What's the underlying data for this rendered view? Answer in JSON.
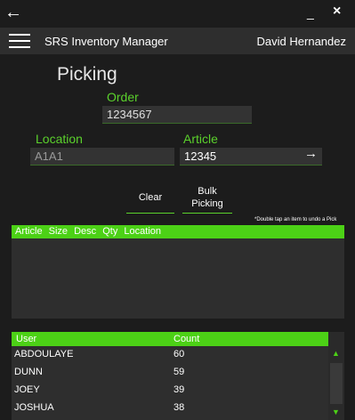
{
  "window": {
    "back": "←",
    "minimize": "_",
    "close": "×"
  },
  "header": {
    "app_title": "SRS Inventory Manager",
    "user_name": "David Hernandez"
  },
  "form": {
    "heading": "Picking",
    "order": {
      "label": "Order",
      "value": "1234567"
    },
    "location": {
      "label": "Location",
      "value": "A1A1"
    },
    "article": {
      "label": "Article",
      "value": "12345"
    }
  },
  "buttons": {
    "clear": "Clear",
    "bulk_line1": "Bulk",
    "bulk_line2": "Picking"
  },
  "hint": "*Double tap an item to undo a Pick",
  "pick_table": {
    "columns": [
      "Article",
      "Size",
      "Desc",
      "Qty",
      "Location"
    ]
  },
  "user_table": {
    "columns": [
      "User",
      "Count"
    ],
    "rows": [
      {
        "user": "ABDOULAYE",
        "count": "60"
      },
      {
        "user": "DUNN",
        "count": "59"
      },
      {
        "user": "JOEY",
        "count": "39"
      },
      {
        "user": "JOSHUA",
        "count": "38"
      }
    ]
  },
  "colors": {
    "accent": "#4cd116",
    "background": "#1c1c1c",
    "panel": "#2e2e2e"
  },
  "icons": {
    "back": "arrow-left-icon",
    "menu": "hamburger-icon",
    "go": "arrow-right-icon"
  }
}
